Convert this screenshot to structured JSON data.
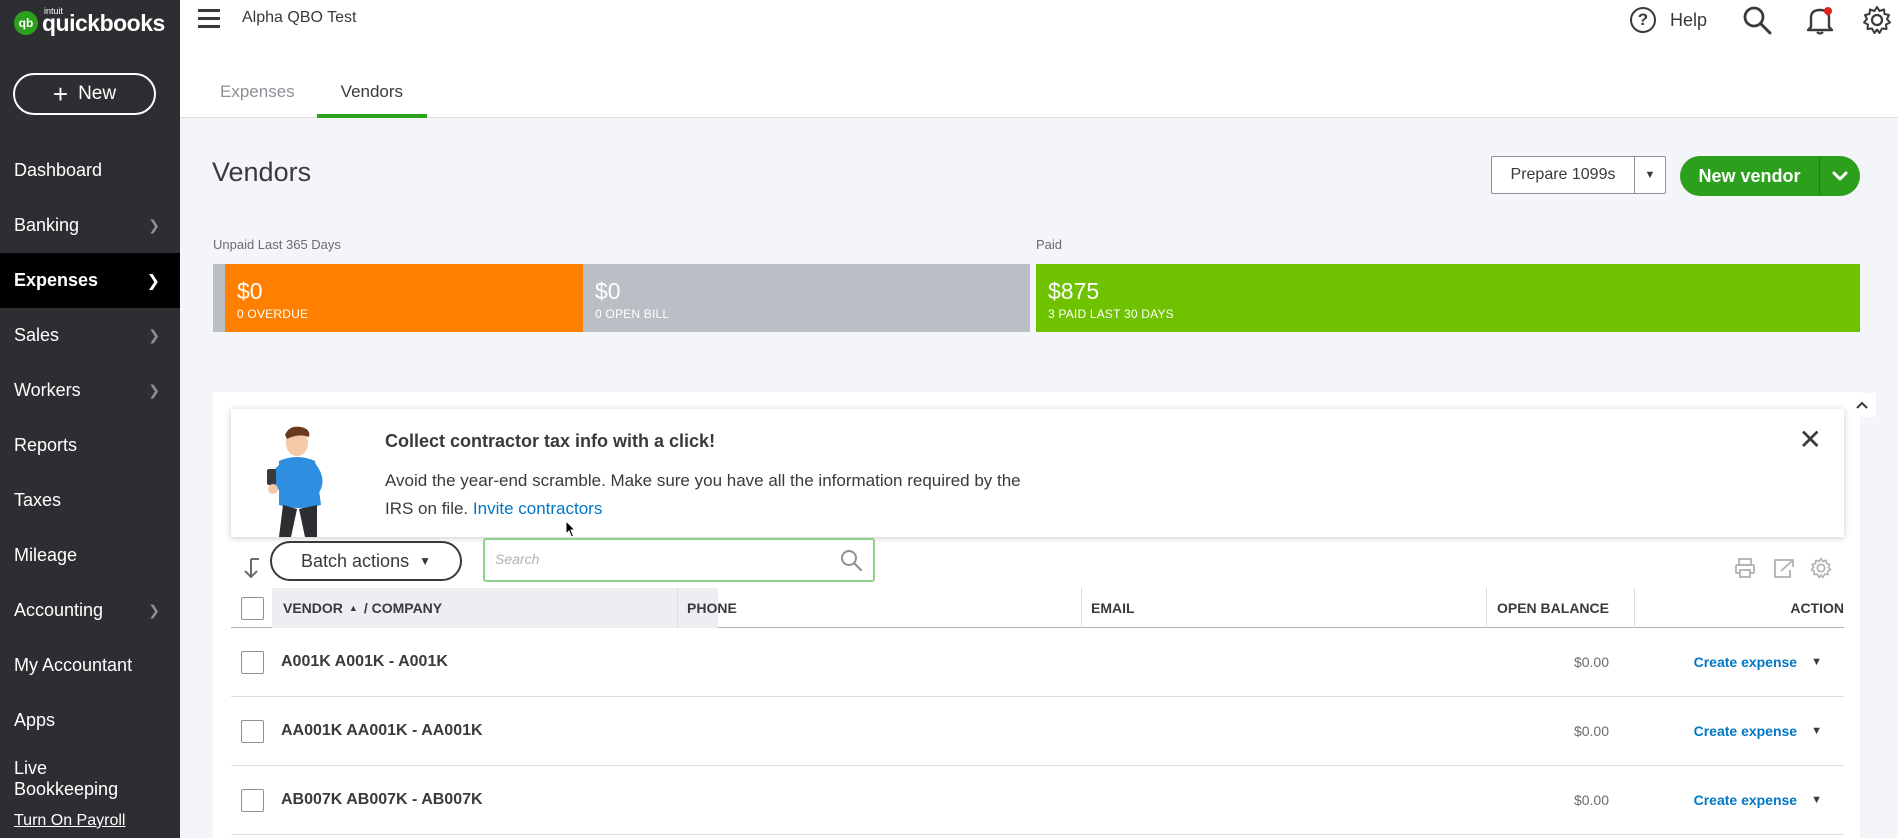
{
  "app": {
    "logo_intuit": "intuit",
    "logo_name": "quickbooks",
    "logo_mark": "qb",
    "company_name": "Alpha QBO Test",
    "help_label": "Help"
  },
  "sidebar": {
    "new_label": "New",
    "items": [
      {
        "label": "Dashboard",
        "chevron": false
      },
      {
        "label": "Banking",
        "chevron": true
      },
      {
        "label": "Expenses",
        "chevron": true,
        "active": true
      },
      {
        "label": "Sales",
        "chevron": true
      },
      {
        "label": "Workers",
        "chevron": true
      },
      {
        "label": "Reports",
        "chevron": false
      },
      {
        "label": "Taxes",
        "chevron": false
      },
      {
        "label": "Mileage",
        "chevron": false
      },
      {
        "label": "Accounting",
        "chevron": true
      },
      {
        "label": "My Accountant",
        "chevron": false
      },
      {
        "label": "Apps",
        "chevron": false
      },
      {
        "label": "Live Bookkeeping",
        "chevron": false
      }
    ],
    "payroll_link": "Turn On Payroll"
  },
  "tabs": [
    {
      "label": "Expenses",
      "active": false
    },
    {
      "label": "Vendors",
      "active": true
    }
  ],
  "page": {
    "title": "Vendors",
    "prepare_label": "Prepare 1099s",
    "new_vendor_label": "New vendor"
  },
  "money_bar": {
    "unpaid_label": "Unpaid Last 365 Days",
    "paid_label": "Paid",
    "segments": [
      {
        "amount": "$0",
        "sub": "0 OVERDUE",
        "color": "#ff8000"
      },
      {
        "amount": "$0",
        "sub": "0 OPEN BILL",
        "color": "#babec5"
      },
      {
        "amount": "$875",
        "sub": "3 PAID LAST 30 DAYS",
        "color": "#6fc200"
      }
    ]
  },
  "banner": {
    "title": "Collect contractor tax info with a click!",
    "text": "Avoid the year-end scramble. Make sure you have all the information required by the IRS on file.",
    "link": "Invite contractors"
  },
  "toolbar": {
    "batch_label": "Batch actions",
    "search_placeholder": "Search"
  },
  "table": {
    "headers": {
      "vendor": "VENDOR",
      "company": "/ COMPANY",
      "phone": "PHONE",
      "email": "EMAIL",
      "balance": "OPEN BALANCE",
      "action": "ACTION"
    },
    "rows": [
      {
        "vendor": "A001K A001K - A001K",
        "balance": "$0.00",
        "action": "Create expense"
      },
      {
        "vendor": "AA001K AA001K - AA001K",
        "balance": "$0.00",
        "action": "Create expense"
      },
      {
        "vendor": "AB007K AB007K - AB007K",
        "balance": "$0.00",
        "action": "Create expense"
      }
    ]
  },
  "colors": {
    "brand_green": "#2ca01c",
    "sidebar_bg": "#2d2e31",
    "link_blue": "#0077c5"
  }
}
